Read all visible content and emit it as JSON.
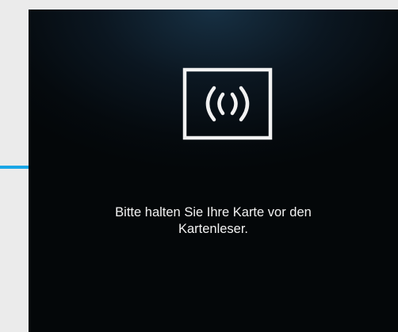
{
  "colors": {
    "background": "#ebebeb",
    "accent": "#1aa6e6",
    "screen": "#050a0e",
    "text": "#f2f2f2"
  },
  "icon": {
    "name": "contactless-card-icon",
    "glyph": "(( ))"
  },
  "instruction": {
    "line1": "Bitte halten Sie Ihre Karte vor den",
    "line2": "Kartenleser."
  }
}
